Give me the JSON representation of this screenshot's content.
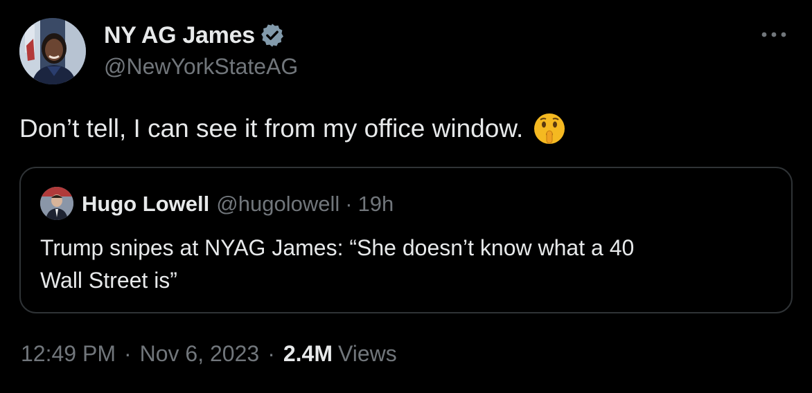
{
  "tweet": {
    "author": {
      "display_name": "NY AG James",
      "handle": "@NewYorkStateAG",
      "verified": true,
      "avatar_icon": "profile-photo"
    },
    "more_icon": "more-dots-icon",
    "text": "Don’t tell, I can see it from my office window.",
    "emoji": "shushing-face-emoji",
    "quote": {
      "display_name": "Hugo Lowell",
      "handle": "@hugolowell",
      "dot": "·",
      "time": "19h",
      "text_line1": "Trump snipes at NYAG James: “She doesn’t know what a 40",
      "text_line2": "Wall Street is”"
    },
    "meta": {
      "time": "12:49 PM",
      "sep1": "·",
      "date": "Nov 6, 2023",
      "sep2": "·",
      "views_count": "2.4M",
      "views_label": "Views"
    }
  },
  "colors": {
    "background": "#000000",
    "text_primary": "#e7e9ea",
    "text_secondary": "#71767b",
    "border": "#2f3336",
    "verified_badge": "#829aab"
  }
}
